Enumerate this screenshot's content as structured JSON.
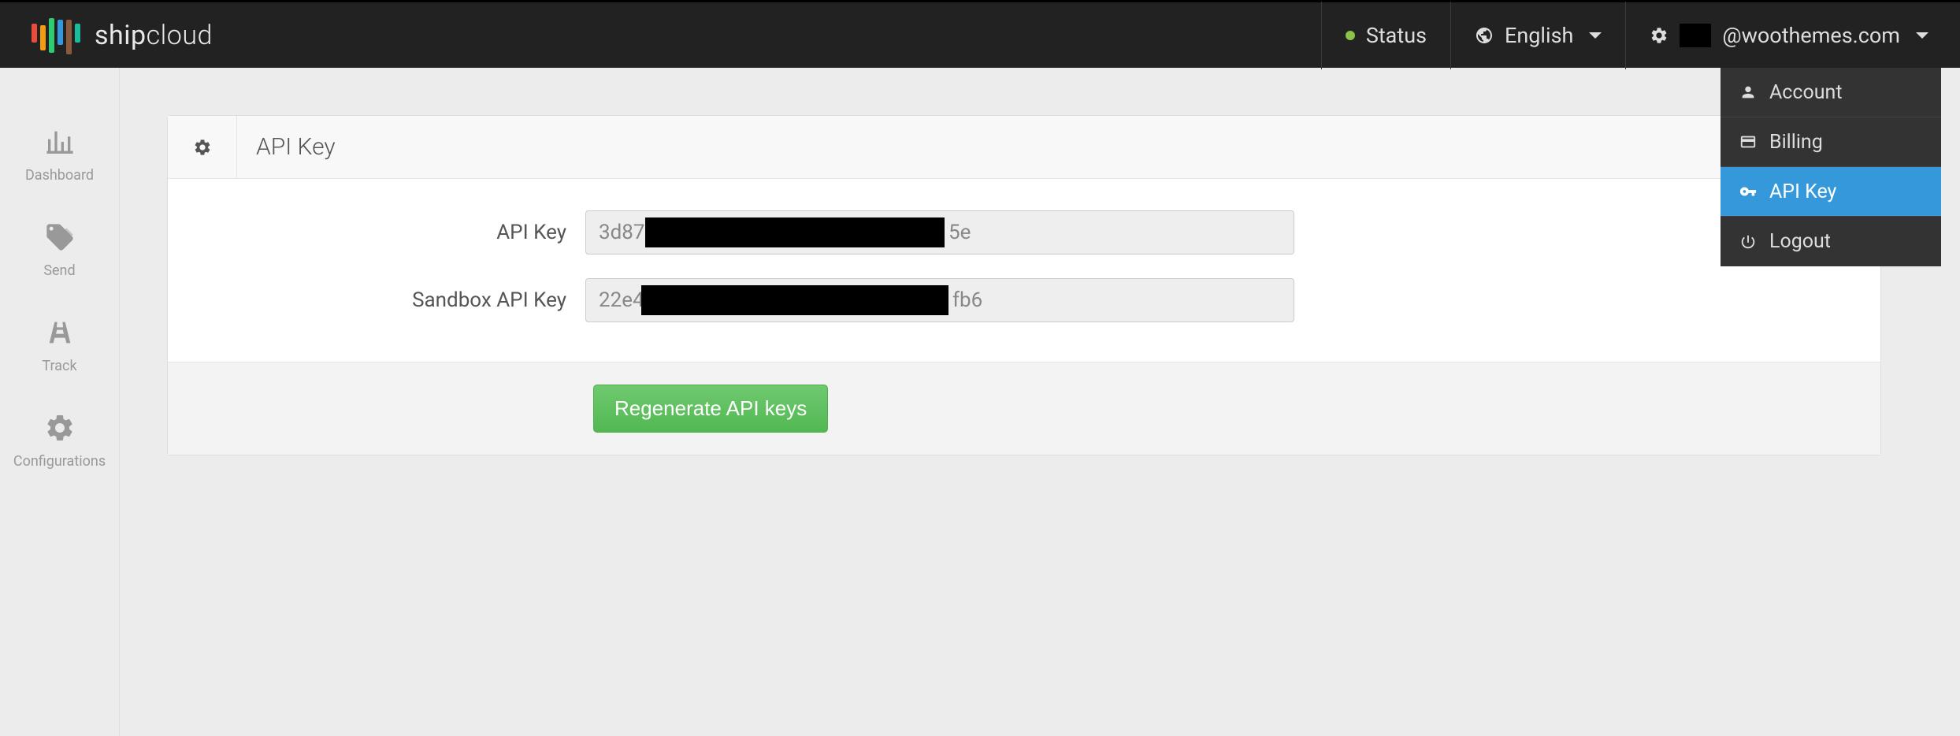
{
  "brand": {
    "name": "shipcloud"
  },
  "topbar": {
    "status": "Status",
    "language": "English",
    "user_suffix": "@woothemes.com"
  },
  "user_menu": {
    "items": [
      {
        "label": "Account",
        "icon": "user"
      },
      {
        "label": "Billing",
        "icon": "card"
      },
      {
        "label": "API Key",
        "icon": "key",
        "active": true
      },
      {
        "label": "Logout",
        "icon": "power"
      }
    ]
  },
  "sidebar": {
    "items": [
      {
        "label": "Dashboard",
        "icon": "bar-chart"
      },
      {
        "label": "Send",
        "icon": "tag"
      },
      {
        "label": "Track",
        "icon": "road"
      },
      {
        "label": "Configurations",
        "icon": "gear"
      }
    ]
  },
  "page": {
    "title": "API Key",
    "fields": {
      "api_key": {
        "label": "API Key",
        "value_prefix": "3d87",
        "value_suffix": "5e"
      },
      "sandbox_key": {
        "label": "Sandbox API Key",
        "value_prefix": "22e4",
        "value_suffix": "fb6"
      }
    },
    "regenerate_button": "Regenerate API keys"
  }
}
